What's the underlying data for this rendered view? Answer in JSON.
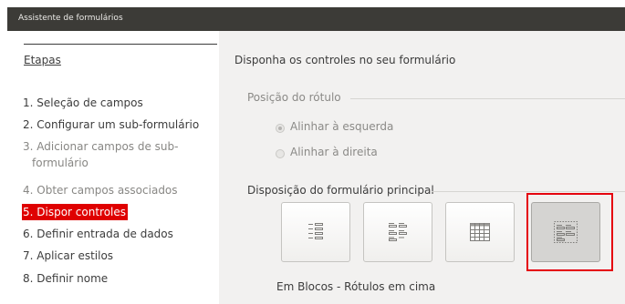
{
  "window": {
    "title": "Assistente de formulários"
  },
  "sidebar": {
    "title": "Etapas",
    "steps": [
      {
        "label": "1. Seleção de campos",
        "state": "normal"
      },
      {
        "label": "2. Configurar um sub-formulário",
        "state": "normal"
      },
      {
        "label": "3. Adicionar campos de sub-",
        "label_cont": "formulário",
        "state": "disabled"
      },
      {
        "label": "4. Obter campos associados",
        "state": "disabled"
      },
      {
        "label": "5. Dispor controles",
        "state": "selected"
      },
      {
        "label": "6. Definir entrada de dados",
        "state": "normal"
      },
      {
        "label": "7. Aplicar estilos",
        "state": "normal"
      },
      {
        "label": "8. Definir nome",
        "state": "normal"
      }
    ]
  },
  "main": {
    "heading": "Disponha os controles no seu formulário",
    "label_position": {
      "title": "Posição do rótulo",
      "options": [
        {
          "label": "Alinhar à esquerda",
          "checked": true
        },
        {
          "label": "Alinhar à direita",
          "checked": false
        }
      ]
    },
    "main_layout": {
      "title": "Disposição do formulário principal",
      "buttons": [
        {
          "icon": "columnar-labels-left-icon",
          "pressed": false
        },
        {
          "icon": "columnar-labels-top-icon",
          "pressed": false
        },
        {
          "icon": "datasheet-icon",
          "pressed": false
        },
        {
          "icon": "in-blocks-labels-above-icon",
          "pressed": true
        }
      ],
      "selected_caption": "Em Blocos - Rótulos em cima"
    }
  },
  "colors": {
    "selection": "#df0000",
    "highlight_box": "#e5000e",
    "titlebar": "#3c3b37"
  }
}
